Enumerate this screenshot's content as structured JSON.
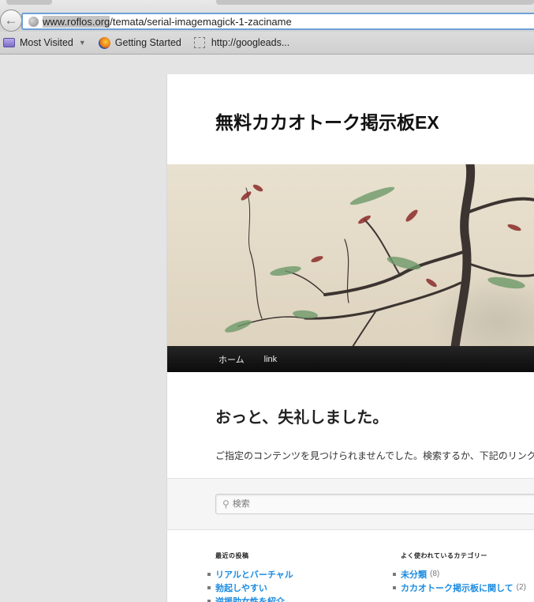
{
  "browser": {
    "url_host": "www.roflos.org",
    "url_path": "/temata/serial-imagemagick-1-zaciname",
    "bookmarks": [
      {
        "label": "Most Visited",
        "icon": "folder-icon"
      },
      {
        "label": "Getting Started",
        "icon": "firefox-icon"
      },
      {
        "label": "http://googleads...",
        "icon": "page-icon"
      }
    ]
  },
  "site": {
    "title": "無料カカオトーク掲示板EX",
    "nav": [
      "ホーム",
      "link"
    ]
  },
  "content": {
    "error_title": "おっと、失礼しました。",
    "error_text": "ご指定のコンテンツを見つけられませんでした。検索するか、下記のリンク"
  },
  "search": {
    "placeholder": "検索"
  },
  "widgets": {
    "recent": {
      "title": "最近の投稿",
      "items": [
        "リアルとバーチャル",
        "勃起しやすい",
        "逆援助女性を紹介"
      ]
    },
    "categories": {
      "title": "よく使われているカテゴリー",
      "items": [
        {
          "label": "未分類",
          "count": "(8)"
        },
        {
          "label": "カカオトーク掲示板に関して",
          "count": "(2)"
        }
      ]
    }
  },
  "colors": {
    "link": "#1b8be0",
    "nav_bg": "#111111",
    "url_focus": "#6fa0d8"
  }
}
